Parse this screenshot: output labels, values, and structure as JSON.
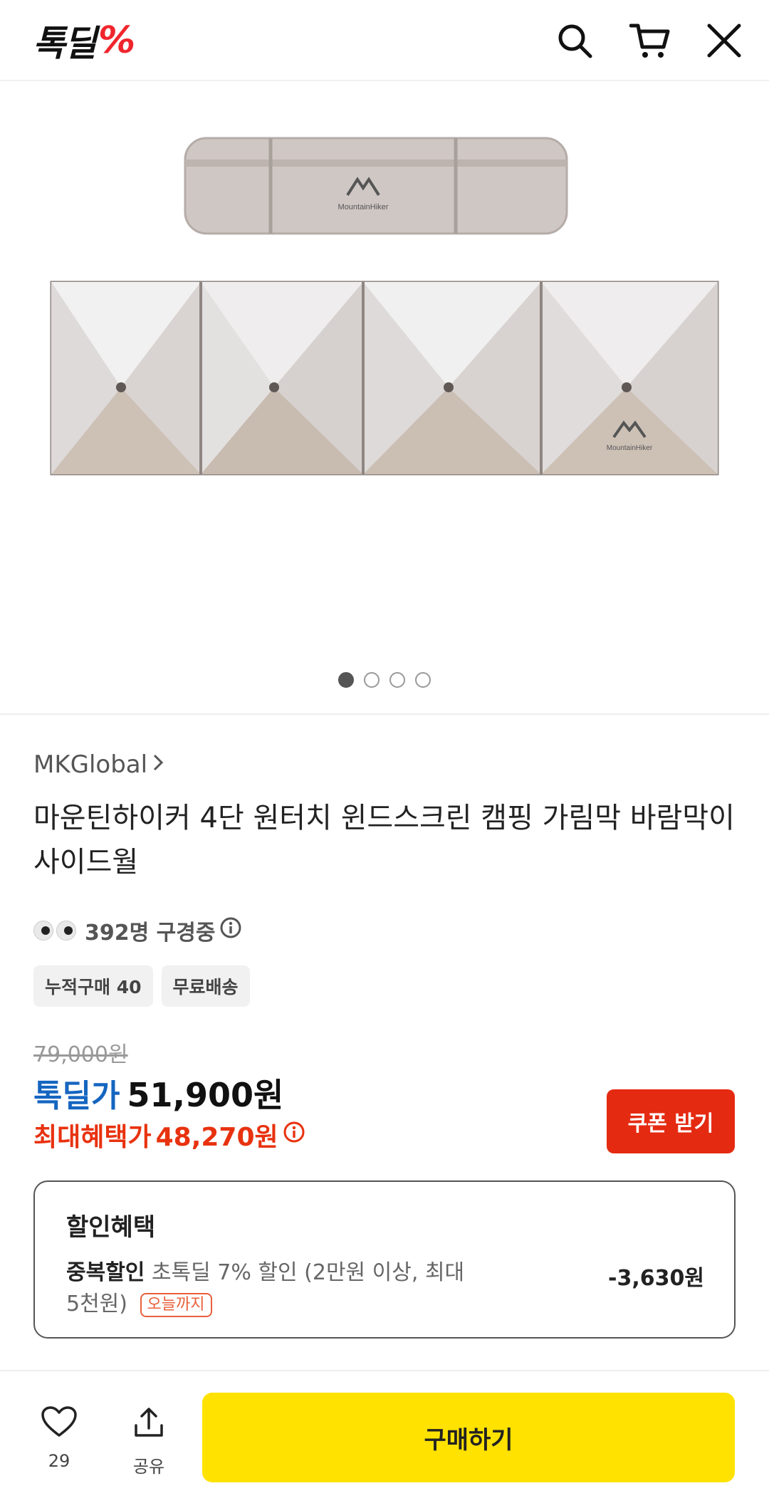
{
  "header": {
    "logo_text": "톡딜",
    "logo_mark": "%",
    "icons": [
      "search-icon",
      "cart-icon",
      "close-icon"
    ]
  },
  "gallery": {
    "brand_mark": "MountainHiker",
    "page_count": 4,
    "active_index": 0
  },
  "product": {
    "seller": "MKGlobal",
    "title": "마운틴하이커 4단 원터치 윈드스크린 캠핑 가림막 바람막이 사이드월",
    "viewers_text": "392명 구경중",
    "chips": [
      "누적구매 40",
      "무료배송"
    ]
  },
  "price": {
    "original": "79,000원",
    "deal_label": "톡딜가",
    "deal_price": "51,900원",
    "max_label": "최대혜택가",
    "max_price": "48,270원",
    "coupon_button": "쿠폰 받기"
  },
  "benefit": {
    "title": "할인혜택",
    "type_label": "중복할인",
    "description": "초톡딜 7% 할인 (2만원 이상, 최대 5천원)",
    "badge": "오늘까지",
    "amount": "-3,630원"
  },
  "bottom_bar": {
    "like_count": "29",
    "share_label": "공유",
    "buy_button": "구매하기"
  },
  "colors": {
    "brand_red": "#f0262d",
    "deal_blue": "#1565c0",
    "benefit_red": "#e8320f",
    "coupon_bg": "#e52a12",
    "buy_yellow": "#ffe200"
  }
}
